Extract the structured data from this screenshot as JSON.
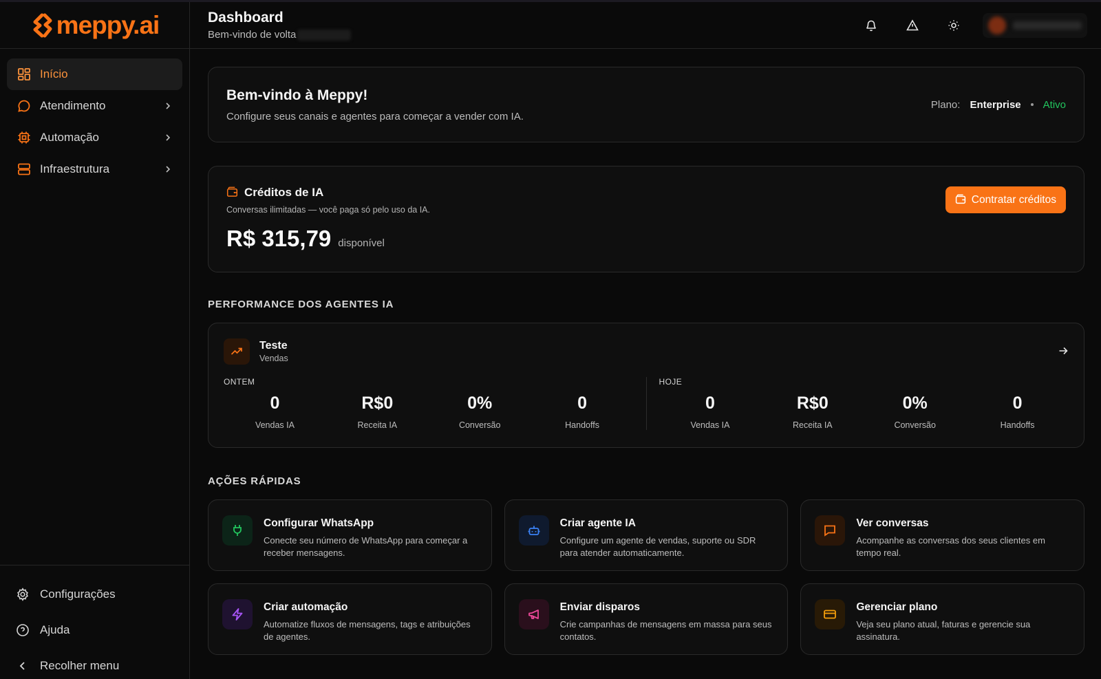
{
  "brand": {
    "name": "meppy.ai",
    "accent": "#f97316"
  },
  "sidebar": {
    "items": [
      {
        "label": "Início",
        "icon": "grid-icon",
        "active": true
      },
      {
        "label": "Atendimento",
        "icon": "chat-bubble-icon"
      },
      {
        "label": "Automação",
        "icon": "cpu-icon"
      },
      {
        "label": "Infraestrutura",
        "icon": "server-icon"
      }
    ],
    "bottom": [
      {
        "label": "Configurações",
        "icon": "gear-icon"
      },
      {
        "label": "Ajuda",
        "icon": "help-circle-icon"
      },
      {
        "label": "Recolher menu",
        "icon": "chevron-left-icon"
      }
    ]
  },
  "header": {
    "title": "Dashboard",
    "subtitle": "Bem-vindo de volta"
  },
  "welcome": {
    "title": "Bem-vindo à Meppy!",
    "description": "Configure seus canais e agentes para começar a vender com IA.",
    "plan_label": "Plano:",
    "plan_value": "Enterprise",
    "plan_status": "Ativo"
  },
  "credits": {
    "title": "Créditos de IA",
    "description": "Conversas ilimitadas — você paga só pelo uso da IA.",
    "amount": "R$ 315,79",
    "available_label": "disponível",
    "button_label": "Contratar créditos"
  },
  "performance": {
    "section_title": "PERFORMANCE DOS AGENTES IA",
    "agent": {
      "name": "Teste",
      "type": "Vendas"
    },
    "yesterday": {
      "label": "ONTEM",
      "stats": [
        {
          "value": "0",
          "label": "Vendas IA"
        },
        {
          "value": "R$0",
          "label": "Receita IA"
        },
        {
          "value": "0%",
          "label": "Conversão"
        },
        {
          "value": "0",
          "label": "Handoffs"
        }
      ]
    },
    "today": {
      "label": "HOJE",
      "stats": [
        {
          "value": "0",
          "label": "Vendas IA"
        },
        {
          "value": "R$0",
          "label": "Receita IA"
        },
        {
          "value": "0%",
          "label": "Conversão"
        },
        {
          "value": "0",
          "label": "Handoffs"
        }
      ]
    }
  },
  "quick_actions": {
    "section_title": "AÇÕES RÁPIDAS",
    "items": [
      {
        "title": "Configurar WhatsApp",
        "description": "Conecte seu número de WhatsApp para começar a receber mensagens.",
        "icon": "plug-icon",
        "color": "#22c55e"
      },
      {
        "title": "Criar agente IA",
        "description": "Configure um agente de vendas, suporte ou SDR para atender automaticamente.",
        "icon": "bot-icon",
        "color": "#3b82f6"
      },
      {
        "title": "Ver conversas",
        "description": "Acompanhe as conversas dos seus clientes em tempo real.",
        "icon": "message-square-icon",
        "color": "#f97316"
      },
      {
        "title": "Criar automação",
        "description": "Automatize fluxos de mensagens, tags e atribuições de agentes.",
        "icon": "zap-icon",
        "color": "#a855f7"
      },
      {
        "title": "Enviar disparos",
        "description": "Crie campanhas de mensagens em massa para seus contatos.",
        "icon": "megaphone-icon",
        "color": "#ec4899"
      },
      {
        "title": "Gerenciar plano",
        "description": "Veja seu plano atual, faturas e gerencie sua assinatura.",
        "icon": "credit-card-icon",
        "color": "#f59e0b"
      }
    ]
  }
}
